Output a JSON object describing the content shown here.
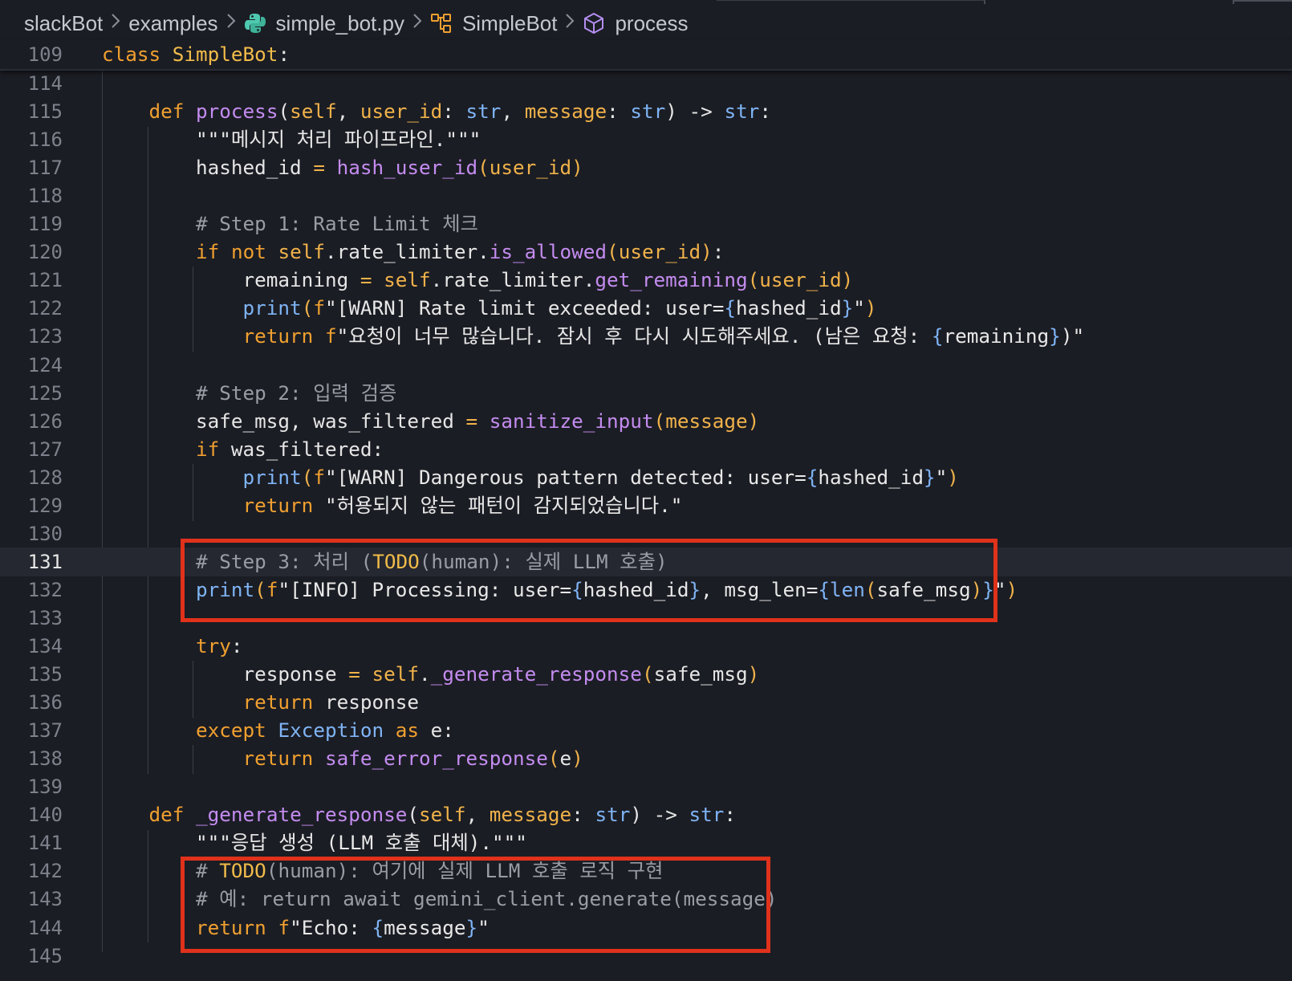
{
  "breadcrumb": {
    "items": [
      "slackBot",
      "examples",
      "simple_bot.py",
      "SimpleBot",
      "process"
    ]
  },
  "sticky": {
    "number": "109",
    "keyword": "class",
    "name": "SimpleBot",
    "colon": ":"
  },
  "colors": {
    "background": "#1b1d24",
    "keyword": "#f0a030",
    "function": "#c48cf0",
    "type": "#7fb4f5",
    "comment": "#9a9ca6",
    "highlight_box": "#e0321b"
  },
  "current_line": "131",
  "lines": [
    {
      "n": "114",
      "tokens": []
    },
    {
      "n": "115",
      "tokens": [
        {
          "t": "    ",
          "c": "o"
        },
        {
          "t": "def",
          "c": "k"
        },
        {
          "t": " ",
          "c": "o"
        },
        {
          "t": "process",
          "c": "f"
        },
        {
          "t": "(",
          "c": "o"
        },
        {
          "t": "self",
          "c": "p"
        },
        {
          "t": ", ",
          "c": "o"
        },
        {
          "t": "user_id",
          "c": "p"
        },
        {
          "t": ": ",
          "c": "o"
        },
        {
          "t": "str",
          "c": "t"
        },
        {
          "t": ", ",
          "c": "o"
        },
        {
          "t": "message",
          "c": "p"
        },
        {
          "t": ": ",
          "c": "o"
        },
        {
          "t": "str",
          "c": "t"
        },
        {
          "t": ") ",
          "c": "o"
        },
        {
          "t": "->",
          "c": "o"
        },
        {
          "t": " ",
          "c": "o"
        },
        {
          "t": "str",
          "c": "t"
        },
        {
          "t": ":",
          "c": "o"
        }
      ]
    },
    {
      "n": "116",
      "tokens": [
        {
          "t": "        ",
          "c": "o"
        },
        {
          "t": "\"\"\"메시지 처리 파이프라인.\"\"\"",
          "c": "st"
        }
      ]
    },
    {
      "n": "117",
      "tokens": [
        {
          "t": "        ",
          "c": "o"
        },
        {
          "t": "hashed_id",
          "c": "o"
        },
        {
          "t": " = ",
          "c": "op"
        },
        {
          "t": "hash_user_id",
          "c": "f"
        },
        {
          "t": "(",
          "c": "bb"
        },
        {
          "t": "user_id",
          "c": "p"
        },
        {
          "t": ")",
          "c": "bb"
        }
      ]
    },
    {
      "n": "118",
      "tokens": []
    },
    {
      "n": "119",
      "tokens": [
        {
          "t": "        ",
          "c": "o"
        },
        {
          "t": "# Step 1: Rate Limit 체크",
          "c": "c"
        }
      ]
    },
    {
      "n": "120",
      "tokens": [
        {
          "t": "        ",
          "c": "o"
        },
        {
          "t": "if",
          "c": "k"
        },
        {
          "t": " ",
          "c": "o"
        },
        {
          "t": "not",
          "c": "k"
        },
        {
          "t": " ",
          "c": "o"
        },
        {
          "t": "self",
          "c": "p"
        },
        {
          "t": ".rate_limiter.",
          "c": "o"
        },
        {
          "t": "is_allowed",
          "c": "f"
        },
        {
          "t": "(",
          "c": "bb"
        },
        {
          "t": "user_id",
          "c": "p"
        },
        {
          "t": ")",
          "c": "bb"
        },
        {
          "t": ":",
          "c": "o"
        }
      ]
    },
    {
      "n": "121",
      "tokens": [
        {
          "t": "            ",
          "c": "o"
        },
        {
          "t": "remaining",
          "c": "o"
        },
        {
          "t": " = ",
          "c": "op"
        },
        {
          "t": "self",
          "c": "p"
        },
        {
          "t": ".rate_limiter.",
          "c": "o"
        },
        {
          "t": "get_remaining",
          "c": "f"
        },
        {
          "t": "(",
          "c": "bb"
        },
        {
          "t": "user_id",
          "c": "p"
        },
        {
          "t": ")",
          "c": "bb"
        }
      ]
    },
    {
      "n": "122",
      "tokens": [
        {
          "t": "            ",
          "c": "o"
        },
        {
          "t": "print",
          "c": "t"
        },
        {
          "t": "(",
          "c": "bb"
        },
        {
          "t": "f",
          "c": "k"
        },
        {
          "t": "\"[WARN] Rate limit exceeded: user=",
          "c": "st"
        },
        {
          "t": "{",
          "c": "t"
        },
        {
          "t": "hashed_id",
          "c": "pr"
        },
        {
          "t": "}",
          "c": "t"
        },
        {
          "t": "\"",
          "c": "st"
        },
        {
          "t": ")",
          "c": "bb"
        }
      ]
    },
    {
      "n": "123",
      "tokens": [
        {
          "t": "            ",
          "c": "o"
        },
        {
          "t": "return",
          "c": "k"
        },
        {
          "t": " ",
          "c": "o"
        },
        {
          "t": "f",
          "c": "k"
        },
        {
          "t": "\"요청이 너무 많습니다. 잠시 후 다시 시도해주세요. (남은 요청: ",
          "c": "st"
        },
        {
          "t": "{",
          "c": "t"
        },
        {
          "t": "remaining",
          "c": "pr"
        },
        {
          "t": "}",
          "c": "t"
        },
        {
          "t": ")\"",
          "c": "st"
        }
      ]
    },
    {
      "n": "124",
      "tokens": []
    },
    {
      "n": "125",
      "tokens": [
        {
          "t": "        ",
          "c": "o"
        },
        {
          "t": "# Step 2: 입력 검증",
          "c": "c"
        }
      ]
    },
    {
      "n": "126",
      "tokens": [
        {
          "t": "        ",
          "c": "o"
        },
        {
          "t": "safe_msg, was_filtered",
          "c": "o"
        },
        {
          "t": " = ",
          "c": "op"
        },
        {
          "t": "sanitize_input",
          "c": "f"
        },
        {
          "t": "(",
          "c": "bb"
        },
        {
          "t": "message",
          "c": "p"
        },
        {
          "t": ")",
          "c": "bb"
        }
      ]
    },
    {
      "n": "127",
      "tokens": [
        {
          "t": "        ",
          "c": "o"
        },
        {
          "t": "if",
          "c": "k"
        },
        {
          "t": " was_filtered:",
          "c": "o"
        }
      ]
    },
    {
      "n": "128",
      "tokens": [
        {
          "t": "            ",
          "c": "o"
        },
        {
          "t": "print",
          "c": "t"
        },
        {
          "t": "(",
          "c": "bb"
        },
        {
          "t": "f",
          "c": "k"
        },
        {
          "t": "\"[WARN] Dangerous pattern detected: user=",
          "c": "st"
        },
        {
          "t": "{",
          "c": "t"
        },
        {
          "t": "hashed_id",
          "c": "pr"
        },
        {
          "t": "}",
          "c": "t"
        },
        {
          "t": "\"",
          "c": "st"
        },
        {
          "t": ")",
          "c": "bb"
        }
      ]
    },
    {
      "n": "129",
      "tokens": [
        {
          "t": "            ",
          "c": "o"
        },
        {
          "t": "return",
          "c": "k"
        },
        {
          "t": " ",
          "c": "o"
        },
        {
          "t": "\"허용되지 않는 패턴이 감지되었습니다.\"",
          "c": "st"
        }
      ]
    },
    {
      "n": "130",
      "tokens": []
    },
    {
      "n": "131",
      "tokens": [
        {
          "t": "        ",
          "c": "o"
        },
        {
          "t": "# Step 3: 처리 (",
          "c": "c"
        },
        {
          "t": "TODO",
          "c": "cl"
        },
        {
          "t": "(human): 실제 LLM 호출)",
          "c": "c"
        }
      ]
    },
    {
      "n": "132",
      "tokens": [
        {
          "t": "        ",
          "c": "o"
        },
        {
          "t": "print",
          "c": "t"
        },
        {
          "t": "(",
          "c": "bb"
        },
        {
          "t": "f",
          "c": "k"
        },
        {
          "t": "\"[INFO] Processing: user=",
          "c": "st"
        },
        {
          "t": "{",
          "c": "t"
        },
        {
          "t": "hashed_id",
          "c": "pr"
        },
        {
          "t": "}",
          "c": "t"
        },
        {
          "t": ", msg_len=",
          "c": "st"
        },
        {
          "t": "{",
          "c": "t"
        },
        {
          "t": "len",
          "c": "t"
        },
        {
          "t": "(",
          "c": "bb"
        },
        {
          "t": "safe_msg",
          "c": "pr"
        },
        {
          "t": ")",
          "c": "bb"
        },
        {
          "t": "}",
          "c": "t"
        },
        {
          "t": "\"",
          "c": "st"
        },
        {
          "t": ")",
          "c": "bb"
        }
      ]
    },
    {
      "n": "133",
      "tokens": []
    },
    {
      "n": "134",
      "tokens": [
        {
          "t": "        ",
          "c": "o"
        },
        {
          "t": "try",
          "c": "k"
        },
        {
          "t": ":",
          "c": "o"
        }
      ]
    },
    {
      "n": "135",
      "tokens": [
        {
          "t": "            ",
          "c": "o"
        },
        {
          "t": "response",
          "c": "o"
        },
        {
          "t": " = ",
          "c": "op"
        },
        {
          "t": "self",
          "c": "p"
        },
        {
          "t": ".",
          "c": "o"
        },
        {
          "t": "_generate_response",
          "c": "f"
        },
        {
          "t": "(",
          "c": "bb"
        },
        {
          "t": "safe_msg",
          "c": "o"
        },
        {
          "t": ")",
          "c": "bb"
        }
      ]
    },
    {
      "n": "136",
      "tokens": [
        {
          "t": "            ",
          "c": "o"
        },
        {
          "t": "return",
          "c": "k"
        },
        {
          "t": " response",
          "c": "o"
        }
      ]
    },
    {
      "n": "137",
      "tokens": [
        {
          "t": "        ",
          "c": "o"
        },
        {
          "t": "except",
          "c": "k"
        },
        {
          "t": " ",
          "c": "o"
        },
        {
          "t": "Exception",
          "c": "t"
        },
        {
          "t": " ",
          "c": "o"
        },
        {
          "t": "as",
          "c": "k"
        },
        {
          "t": " e:",
          "c": "o"
        }
      ]
    },
    {
      "n": "138",
      "tokens": [
        {
          "t": "            ",
          "c": "o"
        },
        {
          "t": "return",
          "c": "k"
        },
        {
          "t": " ",
          "c": "o"
        },
        {
          "t": "safe_error_response",
          "c": "f"
        },
        {
          "t": "(",
          "c": "bb"
        },
        {
          "t": "e",
          "c": "o"
        },
        {
          "t": ")",
          "c": "bb"
        }
      ]
    },
    {
      "n": "139",
      "tokens": []
    },
    {
      "n": "140",
      "tokens": [
        {
          "t": "    ",
          "c": "o"
        },
        {
          "t": "def",
          "c": "k"
        },
        {
          "t": " ",
          "c": "o"
        },
        {
          "t": "_generate_response",
          "c": "f"
        },
        {
          "t": "(",
          "c": "o"
        },
        {
          "t": "self",
          "c": "p"
        },
        {
          "t": ", ",
          "c": "o"
        },
        {
          "t": "message",
          "c": "p"
        },
        {
          "t": ": ",
          "c": "o"
        },
        {
          "t": "str",
          "c": "t"
        },
        {
          "t": ") ",
          "c": "o"
        },
        {
          "t": "->",
          "c": "o"
        },
        {
          "t": " ",
          "c": "o"
        },
        {
          "t": "str",
          "c": "t"
        },
        {
          "t": ":",
          "c": "o"
        }
      ]
    },
    {
      "n": "141",
      "tokens": [
        {
          "t": "        ",
          "c": "o"
        },
        {
          "t": "\"\"\"응답 생성 (LLM 호출 대체).\"\"\"",
          "c": "st"
        }
      ]
    },
    {
      "n": "142",
      "tokens": [
        {
          "t": "        ",
          "c": "o"
        },
        {
          "t": "# ",
          "c": "c"
        },
        {
          "t": "TODO",
          "c": "cl"
        },
        {
          "t": "(human): 여기에 실제 LLM 호출 로직 구현",
          "c": "c"
        }
      ]
    },
    {
      "n": "143",
      "tokens": [
        {
          "t": "        ",
          "c": "o"
        },
        {
          "t": "# 예: return await gemini_client.generate(message)",
          "c": "c"
        }
      ]
    },
    {
      "n": "144",
      "tokens": [
        {
          "t": "        ",
          "c": "o"
        },
        {
          "t": "return",
          "c": "k"
        },
        {
          "t": " ",
          "c": "o"
        },
        {
          "t": "f",
          "c": "k"
        },
        {
          "t": "\"Echo: ",
          "c": "st"
        },
        {
          "t": "{",
          "c": "t"
        },
        {
          "t": "message",
          "c": "pr"
        },
        {
          "t": "}",
          "c": "t"
        },
        {
          "t": "\"",
          "c": "st"
        }
      ]
    },
    {
      "n": "145",
      "tokens": []
    }
  ]
}
